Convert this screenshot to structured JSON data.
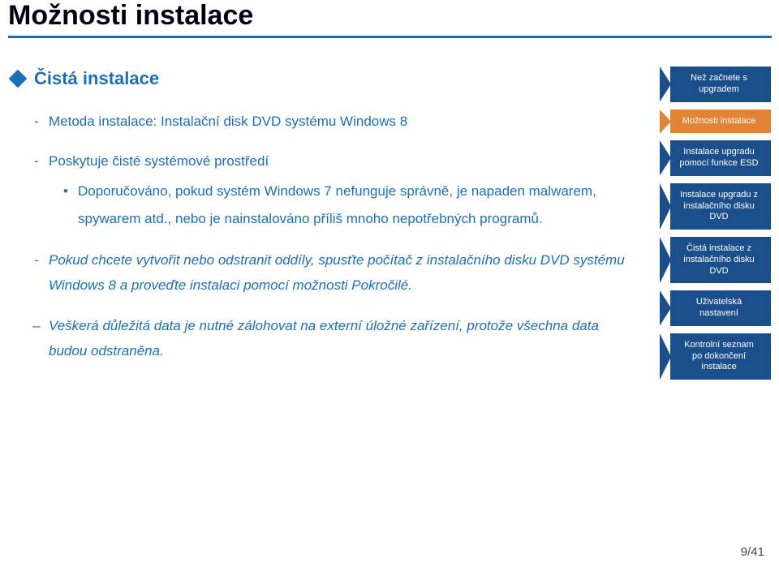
{
  "title": "Možnosti instalace",
  "section": {
    "heading": "Čistá instalace",
    "b1": "Metoda instalace: Instalační disk DVD systému Windows 8",
    "b2": "Poskytuje čisté systémové prostředí",
    "b2_inner": "Doporučováno, pokud systém Windows 7 nefunguje správně, je napaden malwarem, spywarem atd., nebo je nainstalováno příliš mnoho nepotřebných programů.",
    "b3": "Pokud chcete vytvořit nebo odstranit oddíly, spusťte počítač z instalačního disku DVD systému Windows 8 a proveďte instalaci pomocí možnosti Pokročilé.",
    "b4": "Veškerá důležitá data je nutné zálohovat na externí úložné zařízení, protože všechna data budou odstraněna."
  },
  "nav": {
    "items": [
      {
        "label": "Než začnete s upgradem",
        "active": false
      },
      {
        "label": "Možnosti instalace",
        "active": true
      },
      {
        "label": "Instalace upgradu pomocí funkce ESD",
        "active": false
      },
      {
        "label": "Instalace upgradu z instalačního disku DVD",
        "active": false
      },
      {
        "label": "Čistá instalace z instalačního disku DVD",
        "active": false
      },
      {
        "label": "Uživatelská nastavení",
        "active": false
      },
      {
        "label": "Kontrolní seznam po dokončení instalace",
        "active": false
      }
    ]
  },
  "page_number": "9/41",
  "colors": {
    "accent": "#1b6fb8",
    "nav_dark": "#1a4f8b",
    "nav_active": "#e38336"
  }
}
